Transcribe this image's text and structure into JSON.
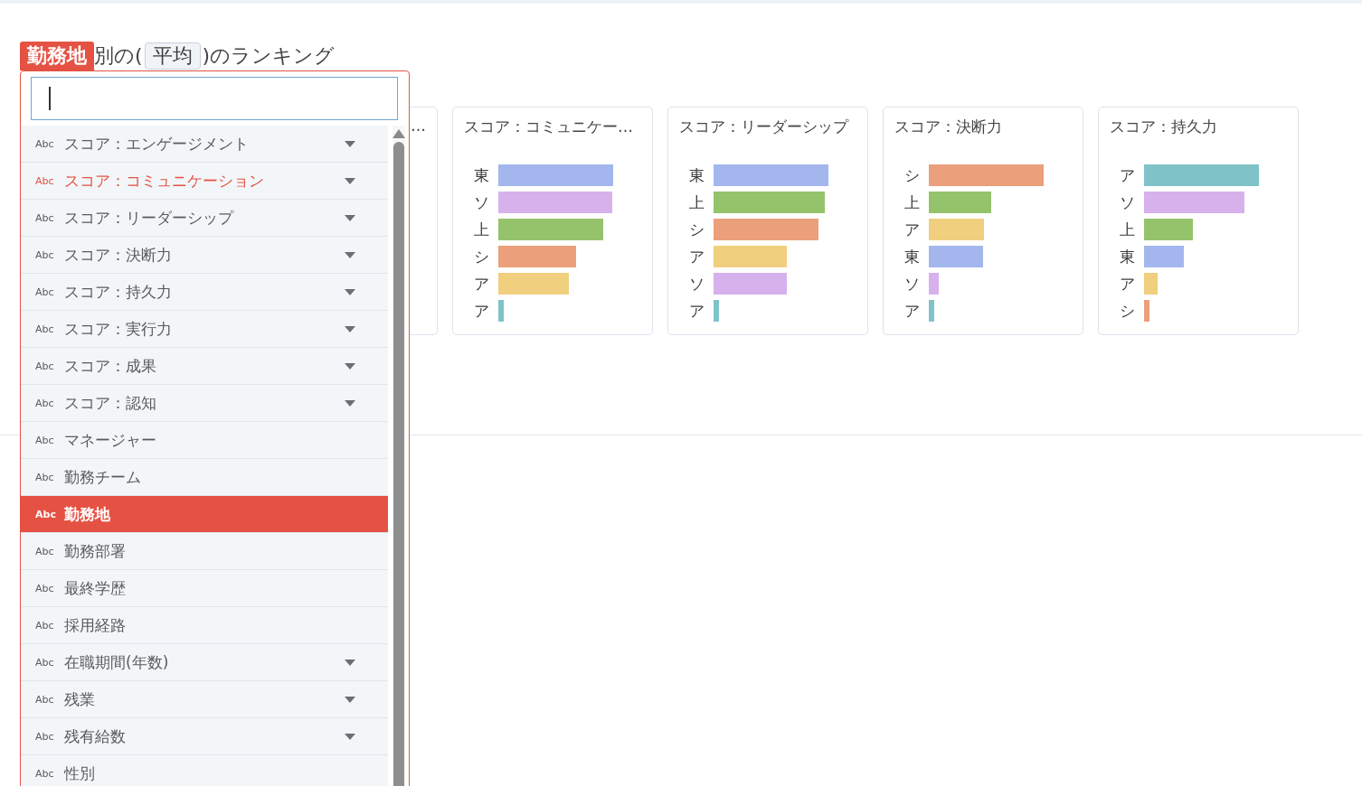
{
  "heading": {
    "field": "勤務地",
    "middle": "別の(",
    "aggregate": "平均",
    "suffix": ")のランキング"
  },
  "dropdown": {
    "items": [
      {
        "type": "Abc",
        "label": "スコア：エンゲージメント",
        "expandable": true,
        "in_use": false,
        "selected": false
      },
      {
        "type": "Abc",
        "label": "スコア：コミュニケーション",
        "expandable": true,
        "in_use": true,
        "selected": false
      },
      {
        "type": "Abc",
        "label": "スコア：リーダーシップ",
        "expandable": true,
        "in_use": false,
        "selected": false
      },
      {
        "type": "Abc",
        "label": "スコア：決断力",
        "expandable": true,
        "in_use": false,
        "selected": false
      },
      {
        "type": "Abc",
        "label": "スコア：持久力",
        "expandable": true,
        "in_use": false,
        "selected": false
      },
      {
        "type": "Abc",
        "label": "スコア：実行力",
        "expandable": true,
        "in_use": false,
        "selected": false
      },
      {
        "type": "Abc",
        "label": "スコア：成果",
        "expandable": true,
        "in_use": false,
        "selected": false
      },
      {
        "type": "Abc",
        "label": "スコア：認知",
        "expandable": true,
        "in_use": false,
        "selected": false
      },
      {
        "type": "Abc",
        "label": "マネージャー",
        "expandable": false,
        "in_use": false,
        "selected": false
      },
      {
        "type": "Abc",
        "label": "勤務チーム",
        "expandable": false,
        "in_use": false,
        "selected": false
      },
      {
        "type": "Abc",
        "label": "勤務地",
        "expandable": false,
        "in_use": false,
        "selected": true
      },
      {
        "type": "Abc",
        "label": "勤務部署",
        "expandable": false,
        "in_use": false,
        "selected": false
      },
      {
        "type": "Abc",
        "label": "最終学歴",
        "expandable": false,
        "in_use": false,
        "selected": false
      },
      {
        "type": "Abc",
        "label": "採用経路",
        "expandable": false,
        "in_use": false,
        "selected": false
      },
      {
        "type": "Abc",
        "label": "在職期間(年数)",
        "expandable": true,
        "in_use": false,
        "selected": false
      },
      {
        "type": "Abc",
        "label": "残業",
        "expandable": true,
        "in_use": false,
        "selected": false
      },
      {
        "type": "Abc",
        "label": "残有給数",
        "expandable": true,
        "in_use": false,
        "selected": false
      },
      {
        "type": "Abc",
        "label": "性別",
        "expandable": false,
        "in_use": false,
        "selected": false
      }
    ]
  },
  "cards": [
    {
      "title": "…"
    },
    {
      "title": "スコア：コミュニケー…",
      "rows": [
        {
          "label": "東",
          "color": "#a3b6ee"
        },
        {
          "label": "ソ",
          "color": "#d6b1ec"
        },
        {
          "label": "上",
          "color": "#95c36b"
        },
        {
          "label": "シ",
          "color": "#eb9f7a"
        },
        {
          "label": "ア",
          "color": "#f0cf7e"
        },
        {
          "label": "ア",
          "color": "#7fc3c8"
        }
      ]
    },
    {
      "title": "スコア：リーダーシップ",
      "rows": [
        {
          "label": "東",
          "color": "#a3b6ee"
        },
        {
          "label": "上",
          "color": "#95c36b"
        },
        {
          "label": "シ",
          "color": "#eb9f7a"
        },
        {
          "label": "ア",
          "color": "#f0cf7e"
        },
        {
          "label": "ソ",
          "color": "#d6b1ec"
        },
        {
          "label": "ア",
          "color": "#7fc3c8"
        }
      ]
    },
    {
      "title": "スコア：決断力",
      "rows": [
        {
          "label": "シ",
          "color": "#eb9f7a"
        },
        {
          "label": "上",
          "color": "#95c36b"
        },
        {
          "label": "ア",
          "color": "#f0cf7e"
        },
        {
          "label": "東",
          "color": "#a3b6ee"
        },
        {
          "label": "ソ",
          "color": "#d6b1ec"
        },
        {
          "label": "ア",
          "color": "#7fc3c8"
        }
      ]
    },
    {
      "title": "スコア：持久力",
      "rows": [
        {
          "label": "ア",
          "color": "#7fc3c8"
        },
        {
          "label": "ソ",
          "color": "#d6b1ec"
        },
        {
          "label": "上",
          "color": "#95c36b"
        },
        {
          "label": "東",
          "color": "#a3b6ee"
        },
        {
          "label": "ア",
          "color": "#f0cf7e"
        },
        {
          "label": "シ",
          "color": "#eb9f7a"
        }
      ]
    }
  ]
}
